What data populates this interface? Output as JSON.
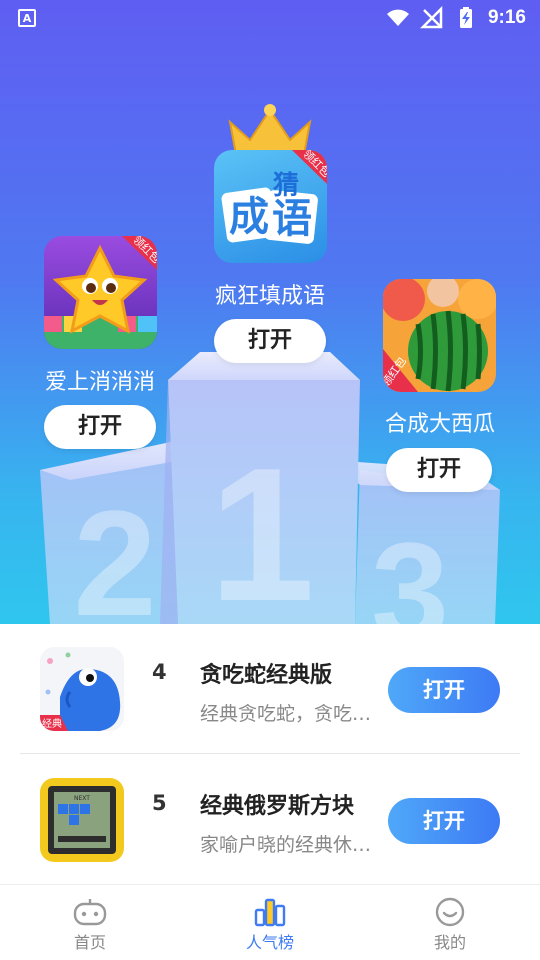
{
  "status_bar": {
    "app_icon_letter": "A",
    "time": "9:16"
  },
  "top3": [
    {
      "rank": "1",
      "name": "疯狂填成语",
      "button": "打开",
      "icon": "idiom-game-icon",
      "icon_text_1": "成",
      "icon_text_2": "语",
      "icon_text_3": "猜",
      "badge": "领红包"
    },
    {
      "rank": "2",
      "name": "爱上消消消",
      "button": "打开",
      "icon": "star-match-game-icon",
      "badge": "领红包"
    },
    {
      "rank": "3",
      "name": "合成大西瓜",
      "button": "打开",
      "icon": "watermelon-game-icon",
      "badge": "领红包"
    }
  ],
  "list": [
    {
      "rank": "4",
      "title": "贪吃蛇经典版",
      "desc": "经典贪吃蛇，贪吃蛇大作战",
      "button": "打开",
      "icon": "snake-game-icon",
      "badge": "经典"
    },
    {
      "rank": "5",
      "title": "经典俄罗斯方块",
      "desc": "家喻户晓的经典休闲游戏",
      "button": "打开",
      "icon": "tetris-game-icon",
      "icon_text": "NEXT"
    }
  ],
  "tabs": [
    {
      "label": "首页",
      "icon": "gamepad-icon",
      "active": false
    },
    {
      "label": "人气榜",
      "icon": "bar-chart-icon",
      "active": true
    },
    {
      "label": "我的",
      "icon": "smiley-icon",
      "active": false
    }
  ],
  "colors": {
    "accent": "#3f7cf3",
    "hero_top": "#5f5ef2",
    "hero_bottom": "#2fc6ee"
  }
}
